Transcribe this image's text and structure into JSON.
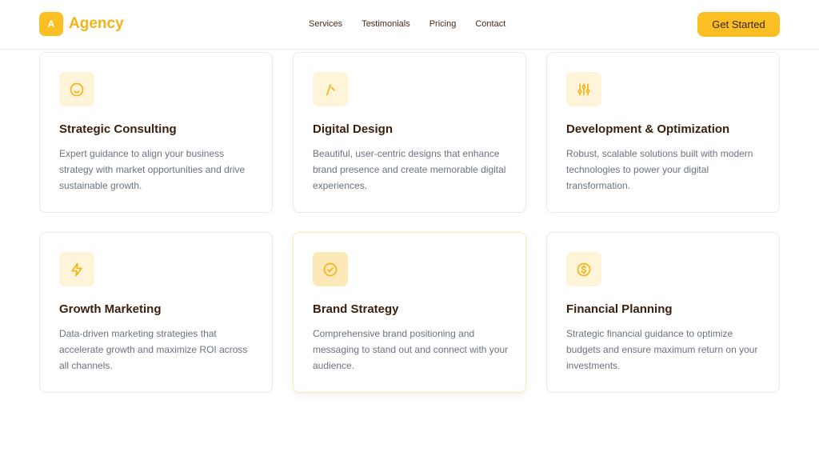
{
  "header": {
    "logo_letter": "A",
    "brand": "Agency",
    "nav": [
      "Services",
      "Testimonials",
      "Pricing",
      "Contact"
    ],
    "cta_label": "Get Started"
  },
  "colors": {
    "accent": "#fbbf24",
    "icon_bg": "#fef4d9",
    "title": "#3b1f0c",
    "body": "#6b7280"
  },
  "services": [
    {
      "icon": "smile-icon",
      "title": "Strategic Consulting",
      "description": "Expert guidance to align your business strategy with market opportunities and drive sustainable growth."
    },
    {
      "icon": "pen-tool-icon",
      "title": "Digital Design",
      "description": "Beautiful, user-centric designs that enhance brand presence and create memorable digital experiences."
    },
    {
      "icon": "sliders-icon",
      "title": "Development & Optimization",
      "description": "Robust, scalable solutions built with modern technologies to power your digital transformation."
    },
    {
      "icon": "lightning-icon",
      "title": "Growth Marketing",
      "description": "Data-driven marketing strategies that accelerate growth and maximize ROI across all channels."
    },
    {
      "icon": "check-circle-icon",
      "title": "Brand Strategy",
      "description": "Comprehensive brand positioning and messaging to stand out and connect with your audience."
    },
    {
      "icon": "dollar-circle-icon",
      "title": "Financial Planning",
      "description": "Strategic financial guidance to optimize budgets and ensure maximum return on your investments."
    }
  ]
}
